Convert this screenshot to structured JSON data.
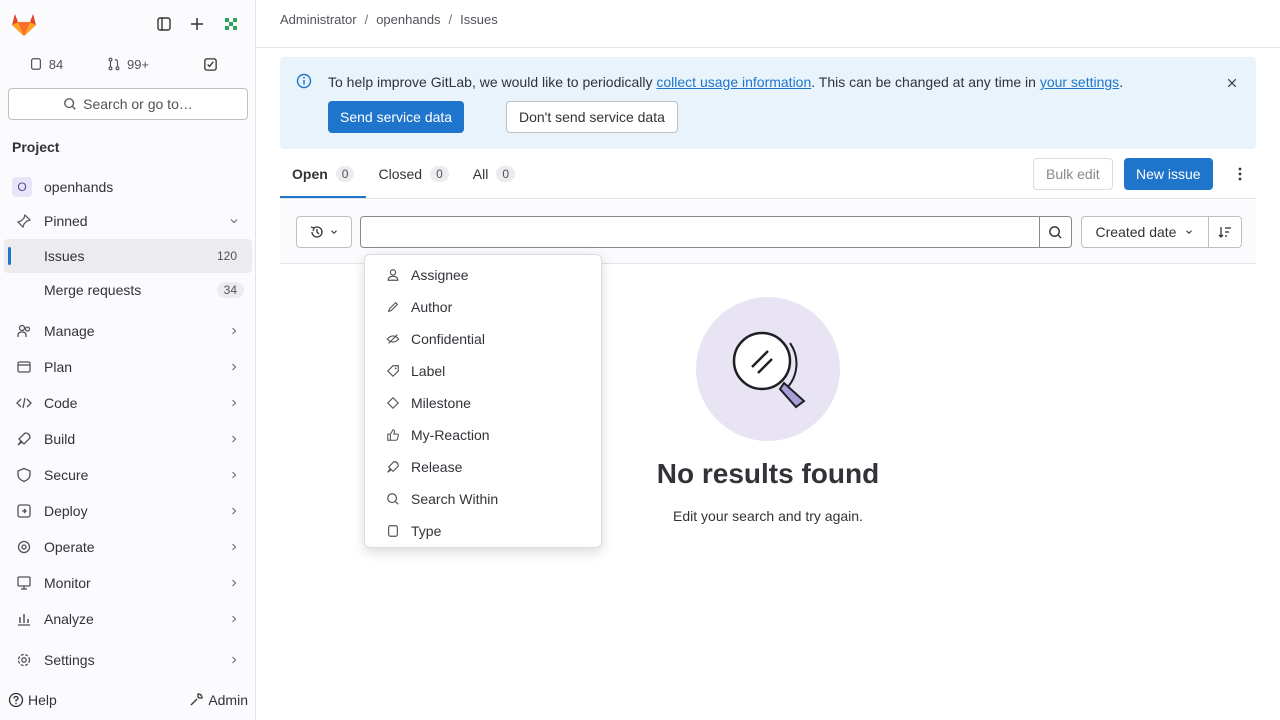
{
  "sidebar": {
    "counters": {
      "issues": "84",
      "merge_requests": "99+"
    },
    "search_label": "Search or go to…",
    "section_title": "Project",
    "project_name": "openhands",
    "project_initial": "O",
    "items": [
      {
        "label": "Pinned"
      },
      {
        "label": "Issues",
        "badge": "120"
      },
      {
        "label": "Merge requests",
        "badge": "34"
      },
      {
        "label": "Manage"
      },
      {
        "label": "Plan"
      },
      {
        "label": "Code"
      },
      {
        "label": "Build"
      },
      {
        "label": "Secure"
      },
      {
        "label": "Deploy"
      },
      {
        "label": "Operate"
      },
      {
        "label": "Monitor"
      },
      {
        "label": "Analyze"
      },
      {
        "label": "Settings"
      }
    ],
    "help_label": "Help",
    "admin_label": "Admin"
  },
  "breadcrumb": [
    "Administrator",
    "openhands",
    "Issues"
  ],
  "banner": {
    "text_before": "To help improve GitLab, we would like to periodically ",
    "link1": "collect usage information",
    "text_middle": ". This can be changed at any time in ",
    "link2": "your settings",
    "text_after": ".",
    "send_label": "Send service data",
    "dont_send_label": "Don't send service data"
  },
  "tabs": [
    {
      "label": "Open",
      "count": "0"
    },
    {
      "label": "Closed",
      "count": "0"
    },
    {
      "label": "All",
      "count": "0"
    }
  ],
  "actions": {
    "bulk_edit": "Bulk edit",
    "new_issue": "New issue"
  },
  "filter": {
    "sort_label": "Created date"
  },
  "dropdown_items": [
    "Assignee",
    "Author",
    "Confidential",
    "Label",
    "Milestone",
    "My-Reaction",
    "Release",
    "Search Within",
    "Type"
  ],
  "empty": {
    "title": "No results found",
    "subtitle": "Edit your search and try again."
  },
  "colors": {
    "accent": "#1f75cb",
    "banner_bg": "#e9f3fc",
    "empty_art_bg": "#e8e4f3"
  }
}
